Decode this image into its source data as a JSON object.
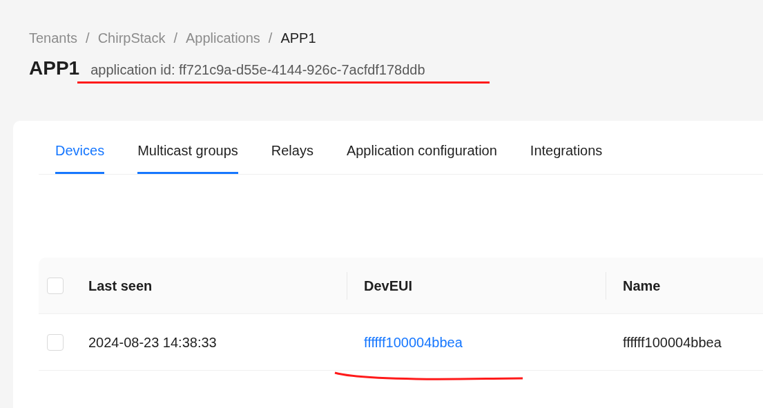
{
  "breadcrumb": [
    "Tenants",
    "ChirpStack",
    "Applications",
    "APP1"
  ],
  "breadcrumb_separator": "/",
  "title": "APP1",
  "subtitle": "application id: ff721c9a-d55e-4144-926c-7acfdf178ddb",
  "tabs": [
    {
      "label": "Devices",
      "selected": true,
      "highlighted": true
    },
    {
      "label": "Multicast groups",
      "selected": false,
      "highlighted": true
    },
    {
      "label": "Relays",
      "selected": false,
      "highlighted": false
    },
    {
      "label": "Application configuration",
      "selected": false,
      "highlighted": false
    },
    {
      "label": "Integrations",
      "selected": false,
      "highlighted": false
    }
  ],
  "table": {
    "header_checked": false,
    "columns": [
      "Last seen",
      "DevEUI",
      "Name"
    ],
    "rows": [
      {
        "checked": false,
        "cells": [
          "2024-08-23 14:38:33",
          "ffffff100004bbea",
          "ffffff100004bbea"
        ]
      }
    ]
  }
}
